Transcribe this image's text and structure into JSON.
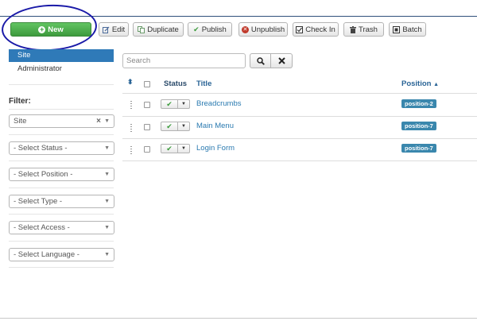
{
  "toolbar": {
    "new": "New",
    "edit": "Edit",
    "duplicate": "Duplicate",
    "publish": "Publish",
    "unpublish": "Unpublish",
    "checkin": "Check In",
    "trash": "Trash",
    "batch": "Batch"
  },
  "sidebar": {
    "site": "Site",
    "administrator": "Administrator",
    "filter_label": "Filter:",
    "filters": [
      "Site",
      "- Select Status -",
      "- Select Position -",
      "- Select Type -",
      "- Select Access -",
      "- Select Language -"
    ]
  },
  "search": {
    "placeholder": "Search"
  },
  "table": {
    "headers": {
      "status": "Status",
      "title": "Title",
      "position": "Position"
    },
    "rows": [
      {
        "title": "Breadcrumbs",
        "position": "position-2",
        "published": true
      },
      {
        "title": "Main Menu",
        "position": "position-7",
        "published": true
      },
      {
        "title": "Login Form",
        "position": "position-7",
        "published": true
      }
    ]
  },
  "colors": {
    "new_button": "#51a351",
    "site_active": "#2f7ab8",
    "badge": "#3a87ad",
    "link": "#2a7ab0",
    "annotation_circle": "#1a1aa8"
  }
}
